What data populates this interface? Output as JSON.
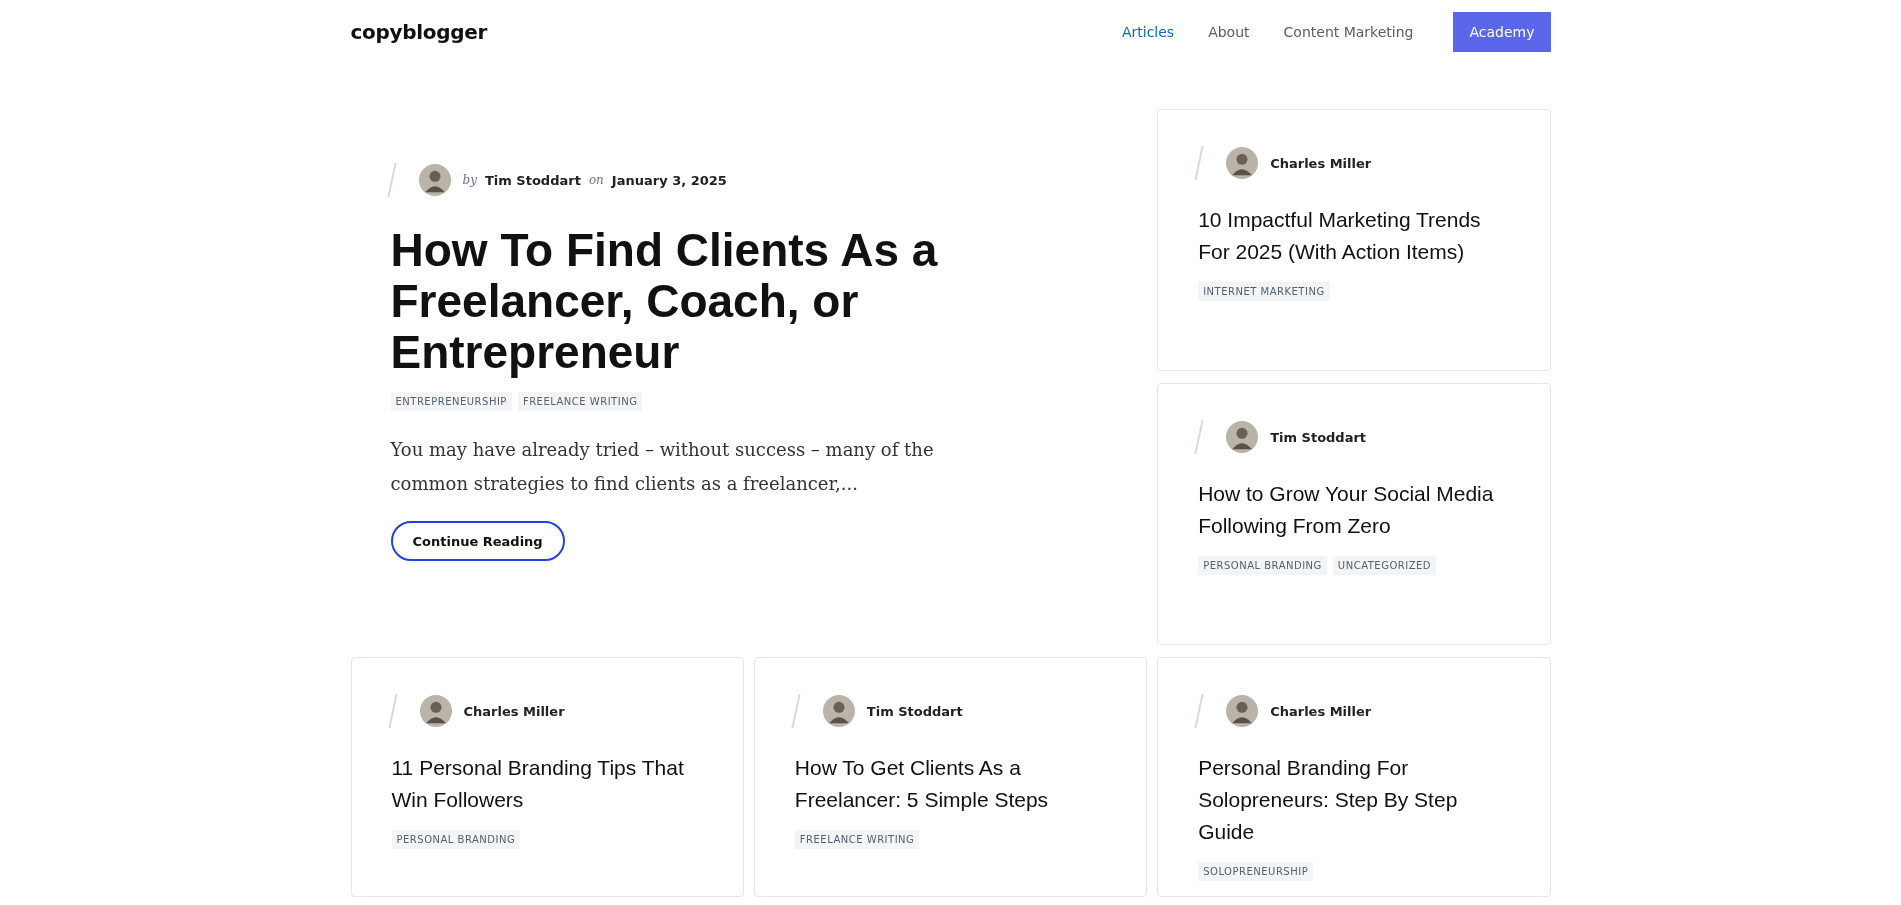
{
  "header": {
    "logo": "copyblogger",
    "nav": [
      {
        "label": "Articles",
        "kind": "link",
        "selected": true
      },
      {
        "label": "About",
        "kind": "link",
        "selected": false
      },
      {
        "label": "Content Marketing",
        "kind": "link",
        "selected": false
      },
      {
        "label": "Academy",
        "kind": "button",
        "selected": false
      }
    ]
  },
  "featured": {
    "by": "by",
    "author": "Tim Stoddart",
    "on": "on",
    "date": "January 3, 2025",
    "title": "How To Find Clients As a Freelancer, Coach, or Entrepreneur",
    "tags": [
      "ENTREPRENEURSHIP",
      "FREELANCE WRITING"
    ],
    "excerpt": "You may have already tried – without success – many of the common strategies to find clients as a freelancer,...",
    "button": "Continue Reading"
  },
  "cards": [
    {
      "author": "Charles Miller",
      "title": "10 Impactful Marketing Trends For 2025 (With Action Items)",
      "tags": [
        "INTERNET MARKETING"
      ]
    },
    {
      "author": "Tim Stoddart",
      "title": "How to Grow Your Social Media Following From Zero",
      "tags": [
        "PERSONAL BRANDING",
        "UNCATEGORIZED"
      ]
    },
    {
      "author": "Charles Miller",
      "title": "11 Personal Branding Tips That Win Followers",
      "tags": [
        "PERSONAL BRANDING"
      ]
    },
    {
      "author": "Tim Stoddart",
      "title": "How To Get Clients As a Freelancer: 5 Simple Steps",
      "tags": [
        "FREELANCE WRITING"
      ]
    },
    {
      "author": "Charles Miller",
      "title": "Personal Branding For Solopreneurs: Step By Step Guide",
      "tags": [
        "SOLOPRENEURSHIP"
      ]
    }
  ]
}
